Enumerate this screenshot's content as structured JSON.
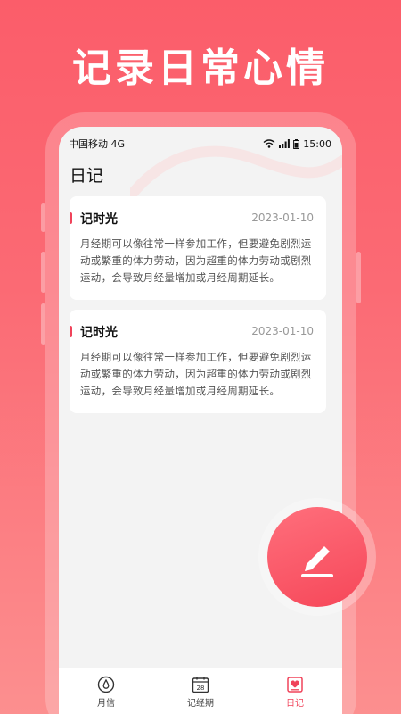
{
  "headline": "记录日常心情",
  "status_bar": {
    "carrier": "中国移动 4G",
    "time": "15:00"
  },
  "page": {
    "title": "日记"
  },
  "entries": [
    {
      "title": "记时光",
      "date": "2023-01-10",
      "body": "月经期可以像往常一样参加工作，但要避免剧烈运动或繁重的体力劳动，因为超重的体力劳动或剧烈运动，会导致月经量增加或月经周期延长。"
    },
    {
      "title": "记时光",
      "date": "2023-01-10",
      "body": "月经期可以像往常一样参加工作，但要避免剧烈运动或繁重的体力劳动，因为超重的体力劳动或剧烈运动，会导致月经量增加或月经周期延长。"
    }
  ],
  "tabbar": {
    "items": [
      {
        "label": "月信",
        "icon": "drop-icon"
      },
      {
        "label": "记经期",
        "icon": "calendar-icon",
        "day": "28"
      },
      {
        "label": "日记",
        "icon": "diary-icon"
      }
    ],
    "active_index": 2
  },
  "fab": {
    "icon": "edit-pencil-icon"
  },
  "colors": {
    "brand": "#fb5d6a",
    "accent": "#f0435a",
    "background": "#f3f3f3"
  }
}
